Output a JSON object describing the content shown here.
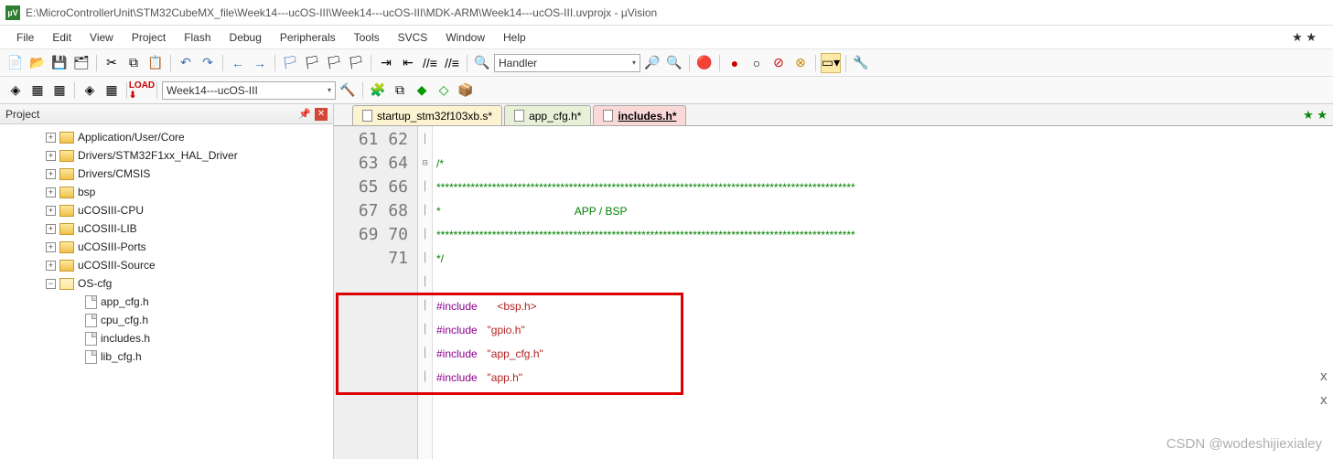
{
  "title": "E:\\MicroControllerUnit\\STM32CubeMX_file\\Week14---ucOS-III\\Week14---ucOS-III\\MDK-ARM\\Week14---ucOS-III.uvprojx - µVision",
  "menu": {
    "file": "File",
    "edit": "Edit",
    "view": "View",
    "project": "Project",
    "flash": "Flash",
    "debug": "Debug",
    "peripherals": "Peripherals",
    "tools": "Tools",
    "svcs": "SVCS",
    "window": "Window",
    "help": "Help"
  },
  "toolbar": {
    "search_text": "Handler",
    "target": "Week14---ucOS-III"
  },
  "project_panel": {
    "title": "Project"
  },
  "tree": [
    {
      "label": "Application/User/Core",
      "depth": 1,
      "expandable": true,
      "open": false,
      "type": "folder"
    },
    {
      "label": "Drivers/STM32F1xx_HAL_Driver",
      "depth": 1,
      "expandable": true,
      "open": false,
      "type": "folder"
    },
    {
      "label": "Drivers/CMSIS",
      "depth": 1,
      "expandable": true,
      "open": false,
      "type": "folder"
    },
    {
      "label": "bsp",
      "depth": 1,
      "expandable": true,
      "open": false,
      "type": "folder"
    },
    {
      "label": "uCOSIII-CPU",
      "depth": 1,
      "expandable": true,
      "open": false,
      "type": "folder"
    },
    {
      "label": "uCOSIII-LIB",
      "depth": 1,
      "expandable": true,
      "open": false,
      "type": "folder"
    },
    {
      "label": "uCOSIII-Ports",
      "depth": 1,
      "expandable": true,
      "open": false,
      "type": "folder"
    },
    {
      "label": "uCOSIII-Source",
      "depth": 1,
      "expandable": true,
      "open": false,
      "type": "folder"
    },
    {
      "label": "OS-cfg",
      "depth": 1,
      "expandable": true,
      "open": true,
      "type": "folder"
    },
    {
      "label": "app_cfg.h",
      "depth": 2,
      "expandable": false,
      "type": "file"
    },
    {
      "label": "cpu_cfg.h",
      "depth": 2,
      "expandable": false,
      "type": "file"
    },
    {
      "label": "includes.h",
      "depth": 2,
      "expandable": false,
      "type": "file"
    },
    {
      "label": "lib_cfg.h",
      "depth": 2,
      "expandable": false,
      "type": "file"
    }
  ],
  "tabs": [
    {
      "label": "startup_stm32f103xb.s*",
      "style": "yellow",
      "active": false
    },
    {
      "label": "app_cfg.h*",
      "style": "green",
      "active": false
    },
    {
      "label": "includes.h*",
      "style": "pink",
      "active": true
    }
  ],
  "code": {
    "lines": [
      {
        "n": "61",
        "fold": "",
        "html": ""
      },
      {
        "n": "62",
        "fold": "⊟",
        "html": "<span class='cmt'>/*</span>"
      },
      {
        "n": "63",
        "fold": "",
        "html": "<span class='cmt'>**************************************************************************************************</span>"
      },
      {
        "n": "64",
        "fold": "",
        "html": "<span class='cmt'>*                                            APP / BSP</span>"
      },
      {
        "n": "65",
        "fold": "",
        "html": "<span class='cmt'>**************************************************************************************************</span>"
      },
      {
        "n": "66",
        "fold": "",
        "html": "<span class='cmt'>*/</span>"
      },
      {
        "n": "67",
        "fold": "",
        "html": ""
      },
      {
        "n": "68",
        "fold": "",
        "html": "<span class='kw'>#include</span>  <span class='str'>&lt;bsp.h&gt;</span>"
      },
      {
        "n": "69",
        "fold": "",
        "html": "<span class='kw'>#include</span> <span class='str'>\"gpio.h\"</span>"
      },
      {
        "n": "70",
        "fold": "",
        "html": "<span class='kw'>#include</span> <span class='str'>\"app_cfg.h\"</span>"
      },
      {
        "n": "71",
        "fold": "",
        "html": "<span class='kw'>#include</span> <span class='str'>\"app.h\"</span>"
      }
    ]
  },
  "watermark": "CSDN @wodeshijiexialey"
}
